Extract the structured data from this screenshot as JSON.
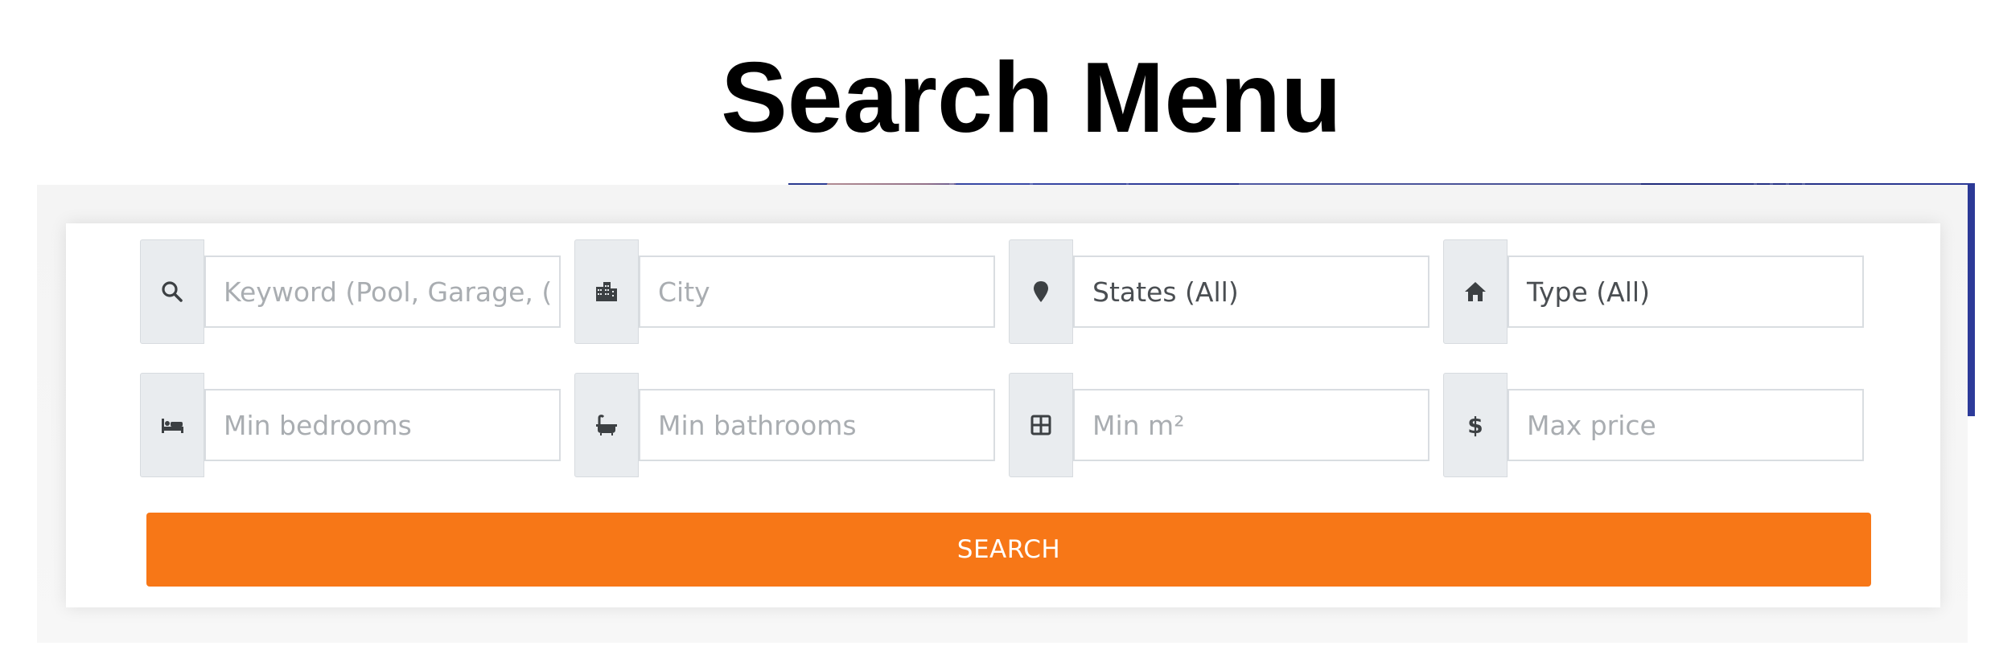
{
  "page_title": "Search Menu",
  "colors": {
    "accent": "#f77717",
    "addon_bg": "#e9ecef",
    "banner_blue": "#26318a"
  },
  "fields": [
    {
      "name": "keyword",
      "icon": "search-icon",
      "placeholder": "Keyword (Pool, Garage, (",
      "value": ""
    },
    {
      "name": "city",
      "icon": "city-buildings-icon",
      "placeholder": "City",
      "value": ""
    },
    {
      "name": "states",
      "icon": "map-marker-icon",
      "placeholder": "",
      "value": "States (All)"
    },
    {
      "name": "type",
      "icon": "home-icon",
      "placeholder": "",
      "value": "Type (All)"
    },
    {
      "name": "min-bedrooms",
      "icon": "bed-icon",
      "placeholder": "Min bedrooms",
      "value": ""
    },
    {
      "name": "min-bathrooms",
      "icon": "bath-icon",
      "placeholder": "Min bathrooms",
      "value": ""
    },
    {
      "name": "min-area",
      "icon": "area-grid-icon",
      "placeholder": "Min m²",
      "value": ""
    },
    {
      "name": "max-price",
      "icon": "dollar-icon",
      "placeholder": "Max price",
      "value": ""
    }
  ],
  "search_button": {
    "label": "SEARCH"
  }
}
